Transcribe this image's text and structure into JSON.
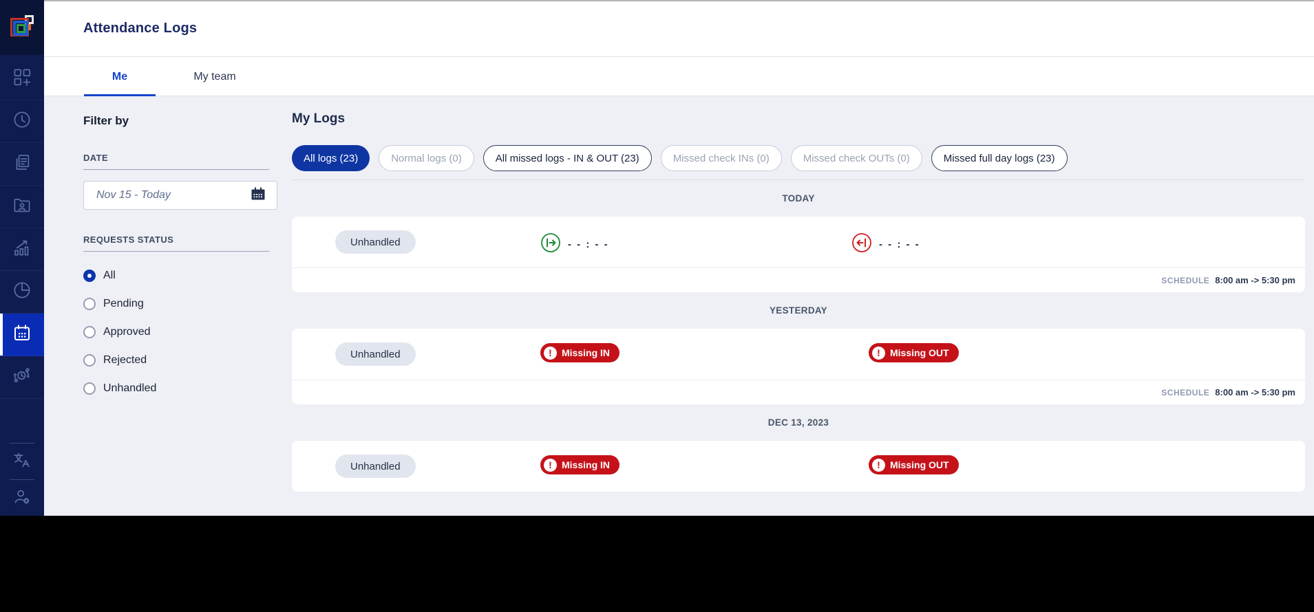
{
  "app": {
    "title": "Attendance Logs"
  },
  "colors": {
    "sidebar_bg": "#0e1c4f",
    "sidebar_active": "#0a2cb5",
    "tab_accent": "#1544c8",
    "chip_active_bg": "#0f35a3",
    "badge_red": "#c51219",
    "checkin_green": "#1c8a3a",
    "checkout_red": "#d01f1f"
  },
  "sidebar": {
    "items": [
      {
        "name": "dashboard"
      },
      {
        "name": "time"
      },
      {
        "name": "documents"
      },
      {
        "name": "employee-folder"
      },
      {
        "name": "performance"
      },
      {
        "name": "reports-pie"
      },
      {
        "name": "attendance-calendar",
        "active": true
      },
      {
        "name": "people-sync"
      }
    ],
    "bottom_items": [
      {
        "name": "language"
      },
      {
        "name": "user-settings"
      }
    ]
  },
  "tabs": [
    {
      "label": "Me",
      "active": true
    },
    {
      "label": "My team",
      "active": false
    }
  ],
  "filter": {
    "title": "Filter by",
    "date": {
      "label": "DATE",
      "value": "Nov 15 - Today"
    },
    "status": {
      "label": "REQUESTS STATUS",
      "options": [
        {
          "label": "All",
          "selected": true
        },
        {
          "label": "Pending",
          "selected": false
        },
        {
          "label": "Approved",
          "selected": false
        },
        {
          "label": "Rejected",
          "selected": false
        },
        {
          "label": "Unhandled",
          "selected": false
        }
      ]
    }
  },
  "main": {
    "title": "My Logs",
    "chips": [
      {
        "label": "All logs (23)",
        "style": "active"
      },
      {
        "label": "Normal logs (0)",
        "style": "muted"
      },
      {
        "label": "All missed logs - IN & OUT (23)",
        "style": "emphasis"
      },
      {
        "label": "Missed check INs (0)",
        "style": "muted"
      },
      {
        "label": "Missed check OUTs (0)",
        "style": "muted"
      },
      {
        "label": "Missed full day logs (23)",
        "style": "emphasis"
      }
    ],
    "sections": [
      {
        "date_label": "TODAY",
        "status": "Unhandled",
        "check_in_time": "- - : - -",
        "check_out_time": "- - : - -",
        "schedule_label": "SCHEDULE",
        "schedule_value": "8:00 am -> 5:30 pm"
      },
      {
        "date_label": "YESTERDAY",
        "status": "Unhandled",
        "missing_in": "Missing IN",
        "missing_out": "Missing OUT",
        "schedule_label": "SCHEDULE",
        "schedule_value": "8:00 am -> 5:30 pm"
      },
      {
        "date_label": "DEC 13, 2023",
        "status": "Unhandled",
        "missing_in": "Missing IN",
        "missing_out": "Missing OUT"
      }
    ]
  }
}
